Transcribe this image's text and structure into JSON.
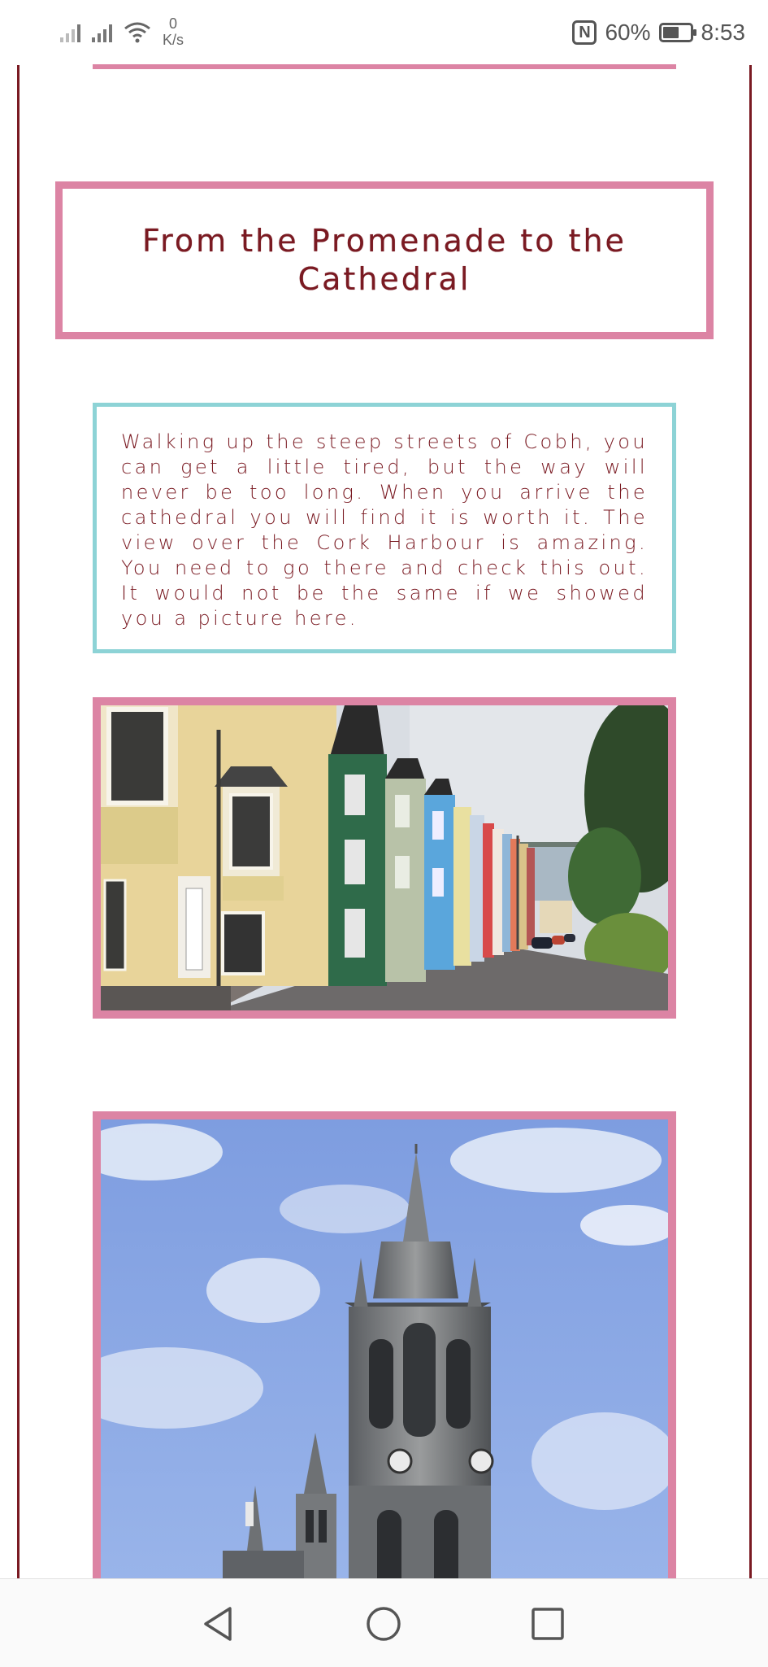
{
  "status_bar": {
    "speed_value": "0",
    "speed_unit": "K/s",
    "battery_percent": "60%",
    "time": "8:53",
    "icons": [
      "signal-weak-icon",
      "signal-roaming-icon",
      "wifi-icon",
      "nfc-icon",
      "battery-icon"
    ]
  },
  "section": {
    "heading": "From the Promenade to the Cathedral",
    "paragraph": "Walking up the steep streets of Cobh, you can get a little tired, but the way will never be too long. When you arrive the cathedral you will find it is worth it. The view over the Cork Harbour is amazing. You need to go there and check this out. It would not be the same if we showed you a picture here."
  },
  "images": [
    {
      "subject": "colorful-terraced-houses-street-photo"
    },
    {
      "subject": "cathedral-spire-photo"
    }
  ],
  "colors": {
    "accent_pink": "#dc84a4",
    "accent_teal": "#8dd3d6",
    "text_maroon": "#7a1a22"
  },
  "nav_bar": {
    "icons": [
      "back-icon",
      "home-icon",
      "recent-apps-icon"
    ]
  }
}
